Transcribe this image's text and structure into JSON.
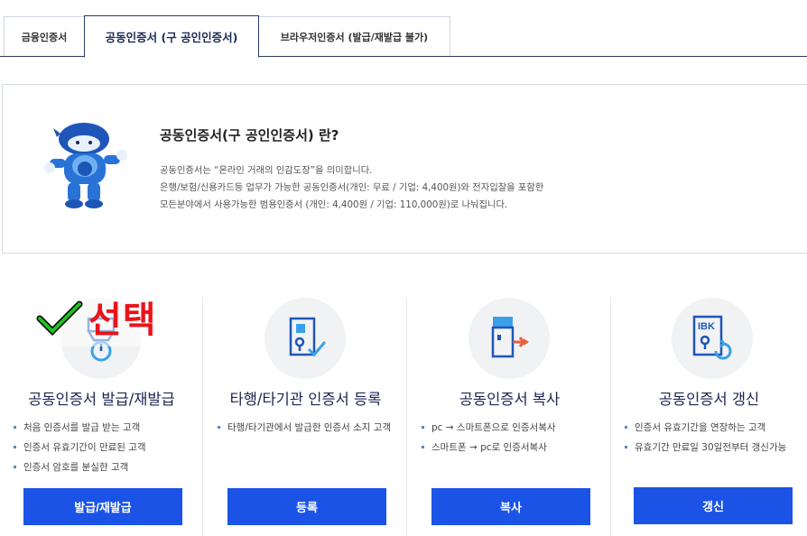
{
  "tabs": [
    {
      "label": "금융인증서"
    },
    {
      "label": "공동인증서 (구 공인인증서)",
      "active": true
    },
    {
      "label": "브라우저인증서 (발급/재발급 불가)"
    }
  ],
  "intro": {
    "title": "공동인증서(구 공인인증서) 란?",
    "lines": [
      "공동인증서는 “온라인 거래의 인감도장”을 의미합니다.",
      "은행/보험/신용카드등 업무가 가능한 공동인증서(개인: 무료 / 기업: 4,400원)와 전자입찰을 포함한",
      "모든분야에서 사용가능한 범용인증서 (개인: 4,400원 / 기업: 110,000원)로 나눠집니다."
    ]
  },
  "cards": [
    {
      "title": "공동인증서 발급/재발급",
      "bullets": [
        "처음 인증서를 발급 받는 고객",
        "인증서 유효기간이 만료된 고객",
        "인증서 암호를 분실한 고객"
      ],
      "button": "발급/재발급"
    },
    {
      "title": "타행/타기관 인증서 등록",
      "bullets": [
        "타행/타기관에서 발급한 인증서 소지 고객"
      ],
      "button": "등록"
    },
    {
      "title": "공동인증서 복사",
      "bullets": [
        "pc → 스마트폰으로 인증서복사",
        "스마트폰 → pc로 인증서복사"
      ],
      "button": "복사"
    },
    {
      "title": "공동인증서 갱신",
      "bullets": [
        "인증서 유효기간을 연장하는 고객",
        "유효기간 만료일 30일전부터 갱신가능"
      ],
      "button": "갱신",
      "icon_text": "IBK"
    }
  ],
  "overlay": {
    "text": "선택",
    "icon": "checkmark-icon"
  },
  "colors": {
    "button": "#1a53e6",
    "navy": "#2a3b66",
    "overlay_red": "#e8141b"
  }
}
